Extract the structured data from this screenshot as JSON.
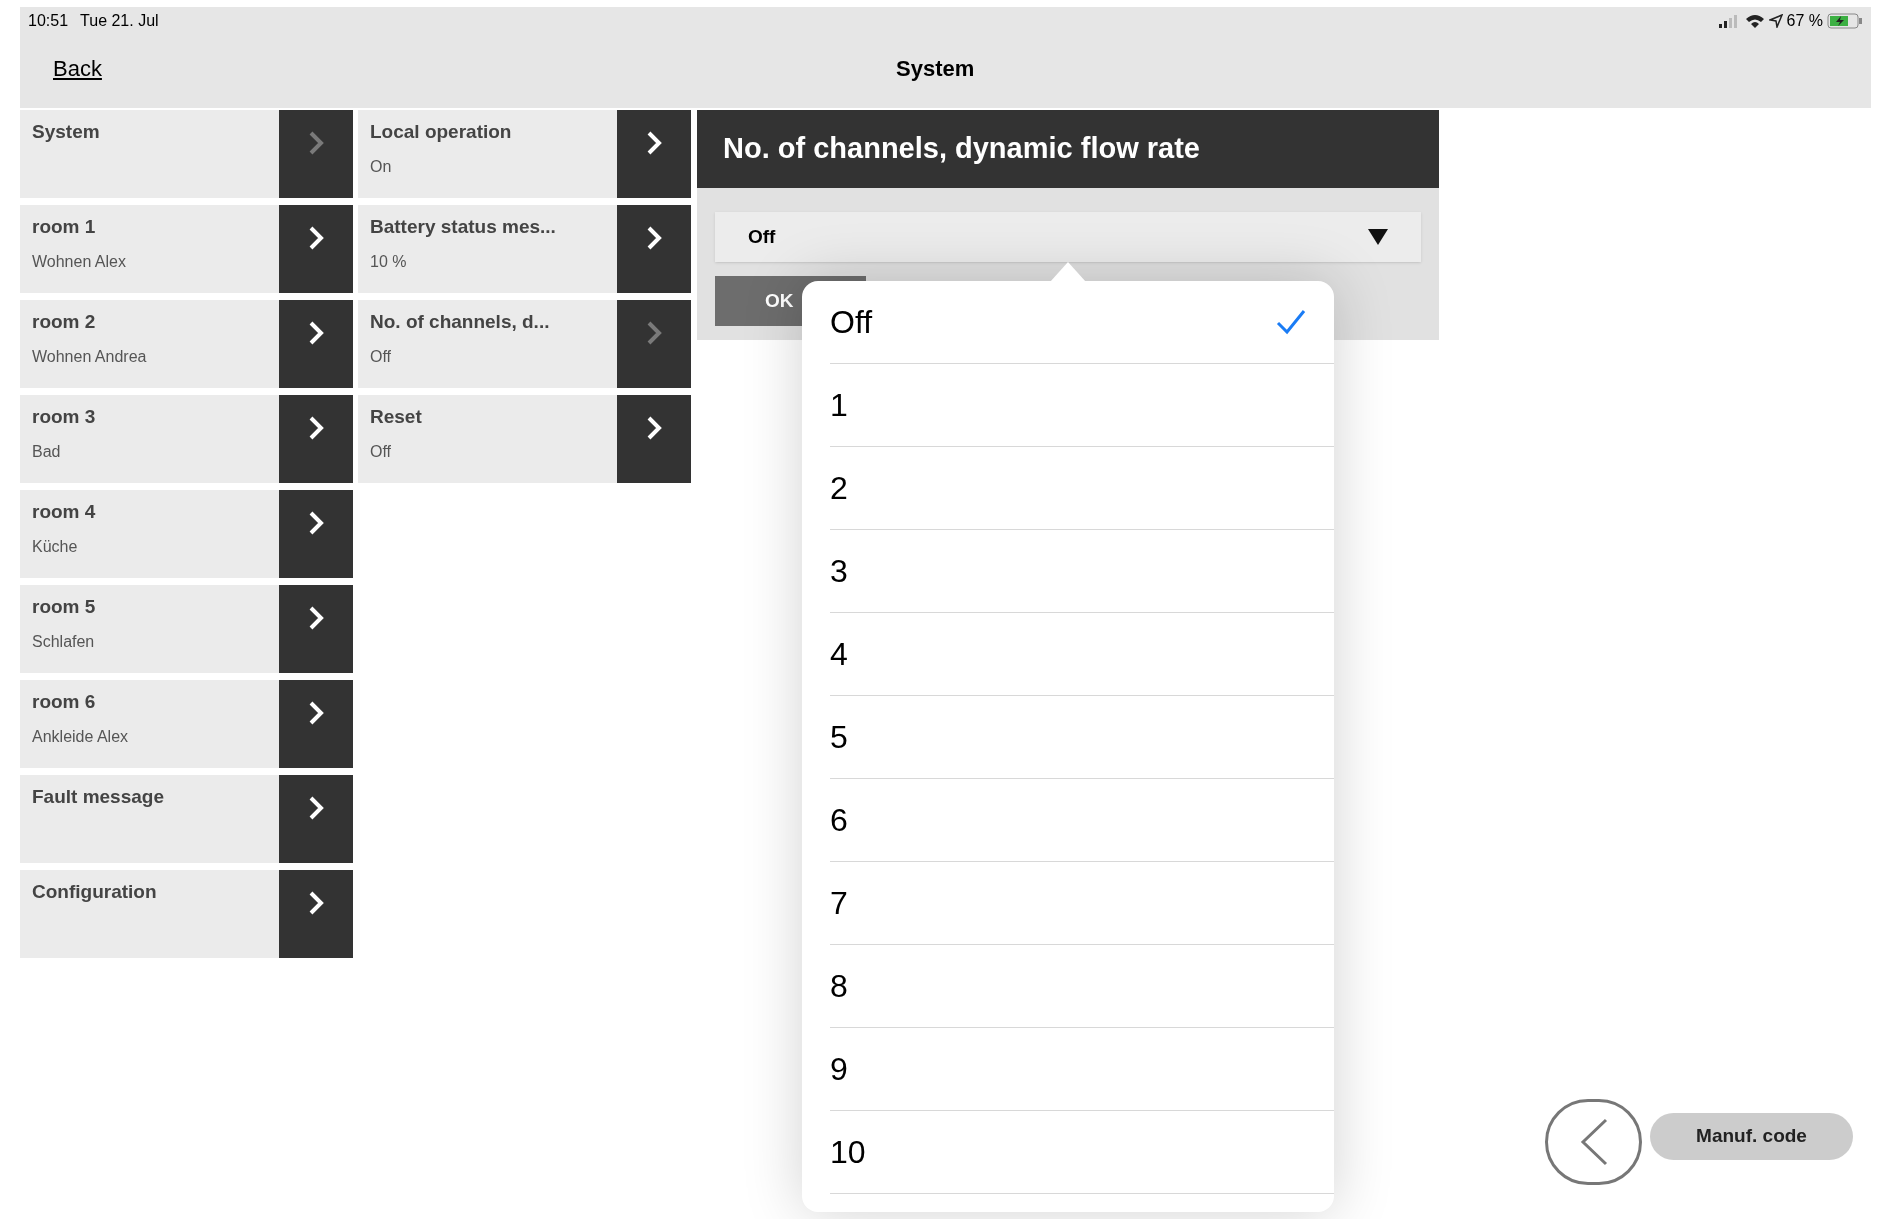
{
  "status_bar": {
    "time": "10:51",
    "date": "Tue 21. Jul",
    "battery": "67 %"
  },
  "nav_bar": {
    "back": "Back",
    "title": "System"
  },
  "menu": [
    {
      "title": "System",
      "selected": true
    },
    {
      "title": "room 1",
      "subtitle": "Wohnen Alex",
      "selected": false
    },
    {
      "title": "room 2",
      "subtitle": "Wohnen Andrea",
      "selected": false
    },
    {
      "title": "room 3",
      "subtitle": "Bad",
      "selected": false
    },
    {
      "title": "room 4",
      "subtitle": "Küche",
      "selected": false
    },
    {
      "title": "room 5",
      "subtitle": "Schlafen",
      "selected": false
    },
    {
      "title": "room 6",
      "subtitle": "Ankleide Alex",
      "selected": false
    },
    {
      "title": "Fault message",
      "selected": false
    },
    {
      "title": "Configuration",
      "selected": false
    }
  ],
  "settings": [
    {
      "title": "Local operation",
      "subtitle": "On",
      "selected": false
    },
    {
      "title": "Battery status mes...",
      "subtitle": "10 %",
      "selected": false
    },
    {
      "title": "No. of channels, d...",
      "subtitle": "Off",
      "selected": true
    },
    {
      "title": "Reset",
      "subtitle": "Off",
      "selected": false
    }
  ],
  "panel": {
    "title": "No. of channels, dynamic flow rate",
    "select_value": "Off",
    "ok_button": "OK"
  },
  "picker": [
    {
      "label": "Off",
      "selected": true
    },
    {
      "label": "1",
      "selected": false
    },
    {
      "label": "2",
      "selected": false
    },
    {
      "label": "3",
      "selected": false
    },
    {
      "label": "4",
      "selected": false
    },
    {
      "label": "5",
      "selected": false
    },
    {
      "label": "6",
      "selected": false
    },
    {
      "label": "7",
      "selected": false
    },
    {
      "label": "8",
      "selected": false
    },
    {
      "label": "9",
      "selected": false
    },
    {
      "label": "10",
      "selected": false
    }
  ],
  "footer": {
    "manuf_code": "Manuf. code"
  }
}
